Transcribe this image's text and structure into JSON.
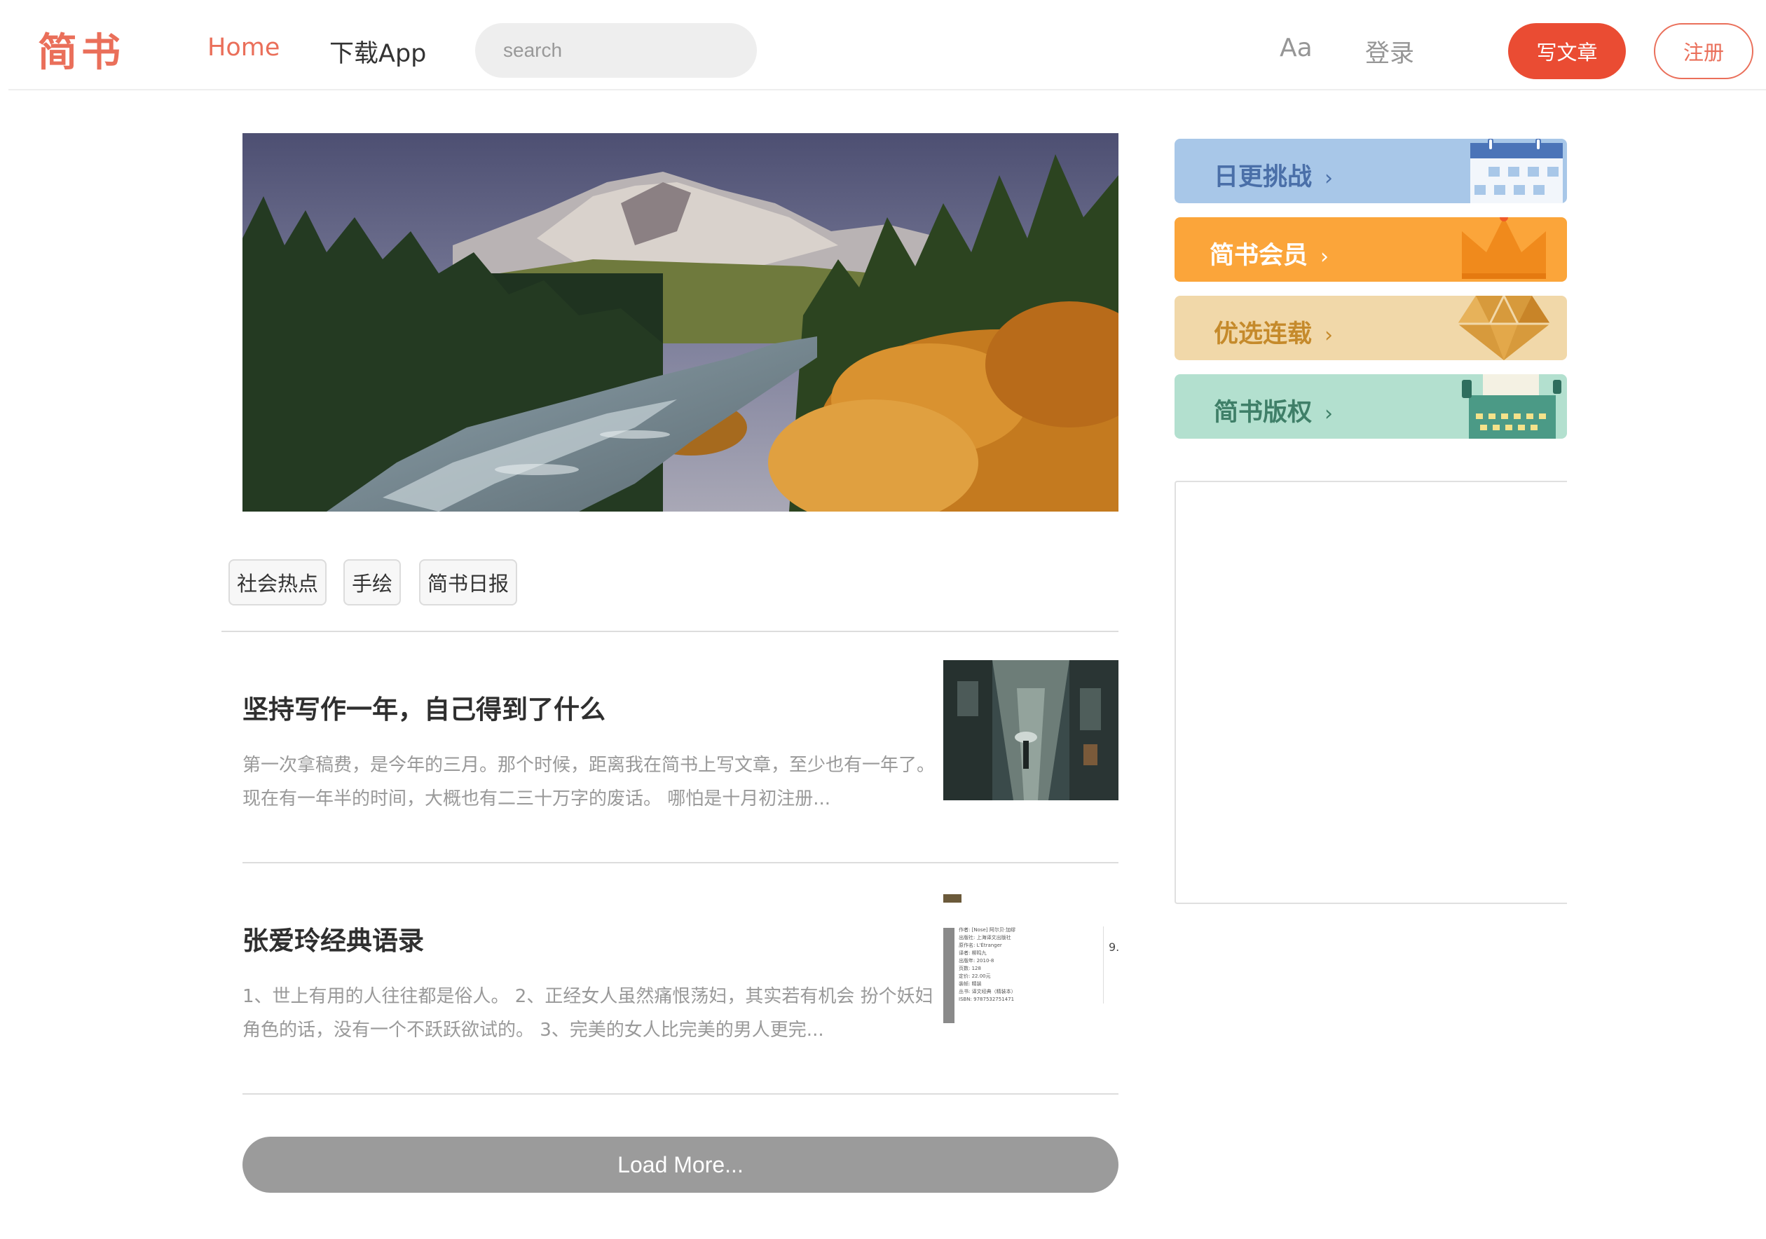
{
  "header": {
    "logo": "简书",
    "nav_home": "Home",
    "nav_app": "下载App",
    "search_placeholder": "search",
    "font_toggle": "Aa",
    "login": "登录",
    "write": "写文章",
    "register": "注册"
  },
  "tags": [
    "社会热点",
    "手绘",
    "简书日报"
  ],
  "articles": [
    {
      "title": "坚持写作一年，自己得到了什么",
      "abstract": "第一次拿稿费，是今年的三月。那个时候，距离我在简书上写文章，至少也有一年了。现在有一年半的时间，大概也有二三十万字的废话。 哪怕是十月初注册..."
    },
    {
      "title": "张爱玲经典语录",
      "abstract": "1、世上有用的人往往都是俗人。 2、正经女人虽然痛恨荡妇，其实若有机会 扮个妖妇角色的话，没有一个不跃跃欲试的。 3、完美的女人比完美的男人更完..."
    }
  ],
  "load_more": "Load More...",
  "side_cards": [
    {
      "label": "日更挑战",
      "arrow": "›",
      "bg": "#a8c7e8",
      "fg": "#4a6fa8",
      "icon": "calendar-icon"
    },
    {
      "label": "简书会员",
      "arrow": "›",
      "bg": "#fba53a",
      "fg": "#ffffff",
      "icon": "crown-icon"
    },
    {
      "label": "优选连载",
      "arrow": "›",
      "bg": "#f1d8a9",
      "fg": "#c58a2b",
      "icon": "diamond-icon"
    },
    {
      "label": "简书版权",
      "arrow": "›",
      "bg": "#b3e0cf",
      "fg": "#3f7f68",
      "icon": "typewriter-icon"
    }
  ],
  "thumb2_text": {
    "author": "作者: [Nose] 阿尔贝·加缪",
    "publisher": "出版社: 上海译文出版社",
    "original": "原作名: L'Étranger",
    "translator": "译者: 柳鸣九",
    "year": "出版年: 2010-8",
    "pages": "页数: 128",
    "price": "定价: 22.00元",
    "binding": "装帧: 精装",
    "series": "丛书: 译文经典（精装本）",
    "isbn": "ISBN: 9787532751471",
    "rating": "9."
  },
  "colors": {
    "brand": "#ea6f5a",
    "write_button": "#ea4c33",
    "load_more": "#9b9b9b"
  }
}
